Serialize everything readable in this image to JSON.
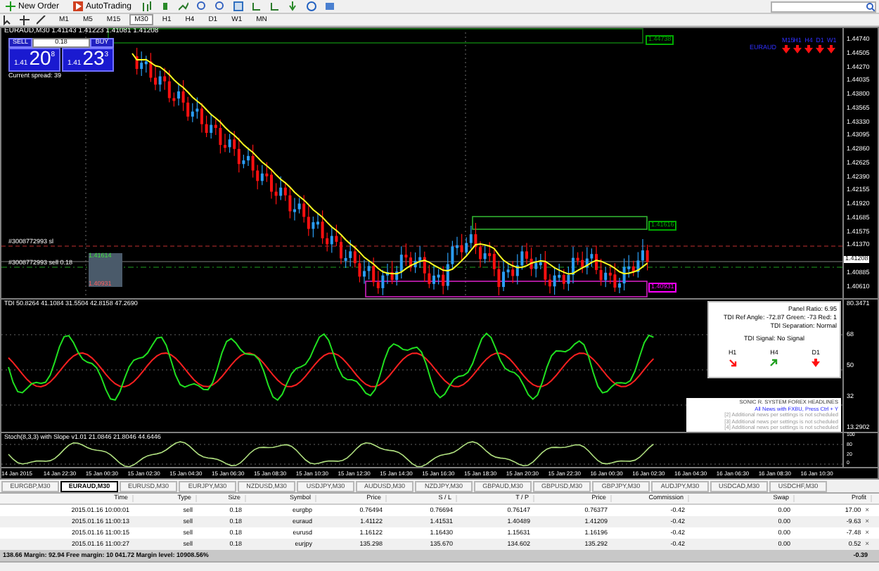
{
  "toolbar": {
    "buttons": [
      {
        "kind": "new-order",
        "label": "New Order"
      },
      {
        "kind": "autotrading",
        "label": "AutoTrading"
      }
    ]
  },
  "timeframes": [
    {
      "label": "M1",
      "selected": false
    },
    {
      "label": "M5",
      "selected": false
    },
    {
      "label": "M15",
      "selected": false
    },
    {
      "label": "M30",
      "selected": true
    },
    {
      "label": "H1",
      "selected": false
    },
    {
      "label": "H4",
      "selected": false
    },
    {
      "label": "D1",
      "selected": false
    },
    {
      "label": "W1",
      "selected": false
    },
    {
      "label": "MN",
      "selected": false
    }
  ],
  "chart": {
    "title": "EURAUD,M30 1.41143 1.41223 1.41081 1.41208",
    "one_click": {
      "sell": "SELL",
      "buy": "BUY",
      "lots": "0.18",
      "sell_big": "1.41",
      "sell_price": "20",
      "sell_sup": "8",
      "buy_big": "1.41",
      "buy_price": "23",
      "buy_sup": "3",
      "spread": "Current spread: 39"
    },
    "mtf": {
      "symbol": "EURAUD",
      "frames": [
        "M15",
        "H1",
        "H4",
        "D1",
        "W1"
      ]
    },
    "box_labels": [
      {
        "text": "1.44738",
        "color": "#00aa00"
      },
      {
        "text": "1.41616",
        "color": "#00aa00"
      },
      {
        "text": "1.40931",
        "color": "#ff00ff"
      }
    ],
    "order_lines": [
      "#3008772993 sl",
      "#3008772993 sell 0.18"
    ],
    "left_levels": [
      "1.41614",
      "1.40931"
    ],
    "price_axis": [
      "1.44740",
      "1.44505",
      "1.44270",
      "1.44035",
      "1.43800",
      "1.43565",
      "1.43330",
      "1.43095",
      "1.42860",
      "1.42625",
      "1.42390",
      "1.42155",
      "1.41920",
      "1.41685",
      "1.41575",
      "1.41370",
      "1.40885",
      "1.40610"
    ],
    "current_price": "1.41208"
  },
  "tdi": {
    "header": "TDI 50.8264 41.1084 31.5504 42.8158 47.2690",
    "axis": [
      "80.3471",
      "68",
      "50",
      "32",
      "13.2902"
    ],
    "panel": {
      "lines": [
        "Panel Ratio: 6.95",
        "TDI Ref Angle: -72.87 Green: -73 Red: 1",
        "TDI Separation: Normal"
      ],
      "signal": "TDI Signal: No Signal",
      "frames": [
        {
          "label": "H1",
          "kind": "down-right"
        },
        {
          "label": "H4",
          "kind": "up-right"
        },
        {
          "label": "D1",
          "kind": "down"
        }
      ]
    },
    "news": {
      "title": "SONIC R. SYSTEM  FOREX HEADLINES",
      "link": "All News with FXBU, Press Ctrl + Y",
      "items": [
        "[2]  Additional news per settings is not scheduled",
        "[3]  Additional news per settings is not scheduled",
        "[4]  Additional news per settings is not scheduled"
      ]
    }
  },
  "stoch": {
    "header": "Stoch(8,3,3) with Slope v1.01 21.0846 21.8046 44.6446",
    "axis": [
      "100",
      "80",
      "20",
      "0"
    ]
  },
  "time_axis": [
    "14 Jan 2015",
    "14 Jan 22:30",
    "15 Jan 00:30",
    "15 Jan 02:30",
    "15 Jan 04:30",
    "15 Jan 06:30",
    "15 Jan 08:30",
    "15 Jan 10:30",
    "15 Jan 12:30",
    "15 Jan 14:30",
    "15 Jan 16:30",
    "15 Jan 18:30",
    "15 Jan 20:30",
    "15 Jan 22:30",
    "16 Jan 00:30",
    "16 Jan 02:30",
    "16 Jan 04:30",
    "16 Jan 06:30",
    "16 Jan 08:30",
    "16 Jan 10:30"
  ],
  "symbol_tabs": [
    {
      "label": "EURGBP,M30",
      "selected": false
    },
    {
      "label": "EURAUD,M30",
      "selected": true
    },
    {
      "label": "EURUSD,M30",
      "selected": false
    },
    {
      "label": "EURJPY,M30",
      "selected": false
    },
    {
      "label": "NZDUSD,M30",
      "selected": false
    },
    {
      "label": "USDJPY,M30",
      "selected": false
    },
    {
      "label": "AUDUSD,M30",
      "selected": false
    },
    {
      "label": "NZDJPY,M30",
      "selected": false
    },
    {
      "label": "GBPAUD,M30",
      "selected": false
    },
    {
      "label": "GBPUSD,M30",
      "selected": false
    },
    {
      "label": "GBPJPY,M30",
      "selected": false
    },
    {
      "label": "AUDJPY,M30",
      "selected": false
    },
    {
      "label": "USDCAD,M30",
      "selected": false
    },
    {
      "label": "USDCHF,M30",
      "selected": false
    }
  ],
  "table": {
    "columns": [
      "Time",
      "Type",
      "Size",
      "Symbol",
      "Price",
      "S / L",
      "T / P",
      "Price",
      "Commission",
      "Swap",
      "Profit"
    ],
    "rows": [
      {
        "cells": [
          "2015.01.16 10:00:01",
          "sell",
          "0.18",
          "eurgbp",
          "0.76494",
          "0.76694",
          "0.76147",
          "0.76377",
          "-0.42",
          "0.00",
          "17.00"
        ],
        "close": "×"
      },
      {
        "cells": [
          "2015.01.16 11:00:13",
          "sell",
          "0.18",
          "euraud",
          "1.41122",
          "1.41531",
          "1.40489",
          "1.41209",
          "-0.42",
          "0.00",
          "-9.63"
        ],
        "close": "×"
      },
      {
        "cells": [
          "2015.01.16 11:00:15",
          "sell",
          "0.18",
          "eurusd",
          "1.16122",
          "1.16430",
          "1.15631",
          "1.16196",
          "-0.42",
          "0.00",
          "-7.48"
        ],
        "close": "×"
      },
      {
        "cells": [
          "2015.01.16 11:00:27",
          "sell",
          "0.18",
          "eurjpy",
          "135.298",
          "135.670",
          "134.602",
          "135.292",
          "-0.42",
          "0.00",
          "0.52"
        ],
        "close": "×"
      }
    ],
    "footer": "138.66  Margin: 92.94  Free margin: 10 041.72  Margin level: 10908.56%",
    "footer_profit": "-0.39"
  }
}
